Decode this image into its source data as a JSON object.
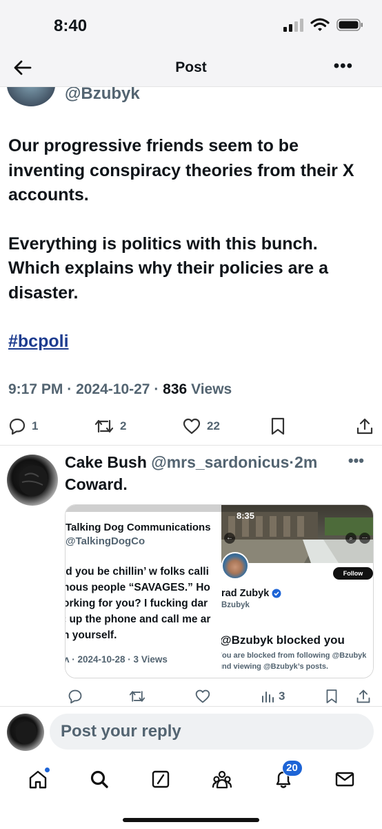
{
  "status_bar": {
    "time": "8:40"
  },
  "nav": {
    "title": "Post"
  },
  "post": {
    "handle": "@Bzubyk",
    "paragraph1": "Our progressive friends seem to be inventing conspiracy theories from their X accounts.",
    "paragraph2": "Everything is politics with this bunch. Which explains why their policies are a disaster.",
    "hashtag": "#bcpoli",
    "time": "9:17 PM",
    "date": "2024-10-27",
    "views_count": "836",
    "views_label": "Views",
    "sep": "·",
    "replies": "1",
    "reposts": "2",
    "likes": "22"
  },
  "reply": {
    "name": "Cake Bush",
    "handle": "@mrs_sardonicus",
    "age": "·2m",
    "text": "Coward.",
    "views": "3",
    "attachment": {
      "left": {
        "account_name": "Talking Dog Communications",
        "account_handle": "@TalkingDogCo",
        "line1": "ıd you be chillin’ w folks calli",
        "line2": "nous people “SAVAGES.” Ho",
        "line3": "orking for you? I fucking dar",
        "line4": "‹ up the phone and call me ar",
        "line5": "n yourself.",
        "meta": "ʌ · 2024-10-28 · 3 Views"
      },
      "right": {
        "time": "8:35",
        "follow_label": "Follow",
        "name": "rad Zubyk",
        "handle": "Bzubyk",
        "blocked_title": "@Bzubyk blocked you",
        "blocked_line1": "ʼou are blocked from following @Bzubyk",
        "blocked_line2": "ınd viewing @Bzubyk’s posts."
      }
    }
  },
  "composer": {
    "placeholder": "Post your reply"
  },
  "tabbar": {
    "notifications_badge": "20"
  },
  "colors": {
    "link": "#1d3c8f",
    "badge": "#1d64d6",
    "muted": "#536471"
  }
}
